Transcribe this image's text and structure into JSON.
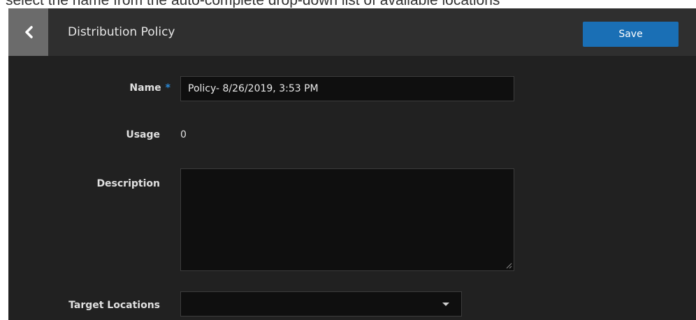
{
  "caption": "select the name from the auto-complete drop-down list of available locations",
  "header": {
    "title": "Distribution Policy",
    "save_label": "Save",
    "back_icon": "chevron-left-icon"
  },
  "form": {
    "name": {
      "label": "Name",
      "required_marker": "*",
      "value": "Policy- 8/26/2019, 3:53 PM"
    },
    "usage": {
      "label": "Usage",
      "value": "0"
    },
    "description": {
      "label": "Description",
      "value": ""
    },
    "target_locations": {
      "label": "Target Locations",
      "value": "",
      "dropdown_icon": "caret-down-icon"
    }
  },
  "colors": {
    "background": "#212121",
    "header": "#2f2f2f",
    "back_button": "#6b6b6b",
    "accent": "#1a6fb5",
    "required": "#2a8ad8",
    "field": "#0f0f0f"
  }
}
